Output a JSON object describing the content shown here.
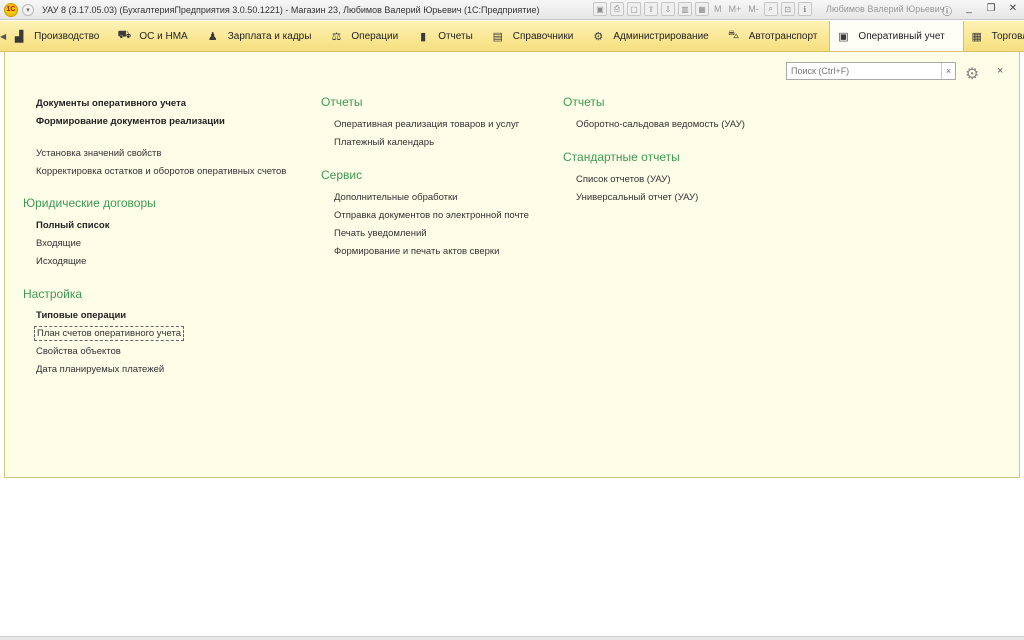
{
  "titlebar": {
    "logo": "1С",
    "title": "УАУ 8 (3.17.05.03) (БухгалтерияПредприятия 3.0.50.1221) - Магазин 23, Любимов Валерий Юрьевич  (1С:Предприятие)",
    "tools": [
      "M",
      "M+",
      "M-"
    ],
    "user": "Любимов Валерий Юрьевич",
    "win_min": "_",
    "win_restore": "❐",
    "win_close": "✕"
  },
  "sections": [
    {
      "label": "Производство",
      "icon": "factory-icon",
      "glyph": "▟"
    },
    {
      "label": "ОС и НМА",
      "icon": "truck-icon",
      "glyph": "⛟"
    },
    {
      "label": "Зарплата и кадры",
      "icon": "person-icon",
      "glyph": "♟"
    },
    {
      "label": "Операции",
      "icon": "operations-icon",
      "glyph": "⚖"
    },
    {
      "label": "Отчеты",
      "icon": "chart-icon",
      "glyph": "▮"
    },
    {
      "label": "Справочники",
      "icon": "books-icon",
      "glyph": "▤"
    },
    {
      "label": "Администрирование",
      "icon": "gear-icon",
      "glyph": "⚙"
    },
    {
      "label": "Автотранспорт",
      "icon": "car-icon",
      "glyph": "⛍"
    },
    {
      "label": "Оперативный учет",
      "icon": "monitor-icon",
      "glyph": "▣"
    },
    {
      "label": "Торговля",
      "icon": "calculator-icon",
      "glyph": "▦"
    }
  ],
  "search": {
    "placeholder": "Поиск (Ctrl+F)",
    "clear": "×"
  },
  "panel": {
    "close": "×"
  },
  "col1": {
    "items_top": [
      {
        "label": "Документы оперативного учета",
        "bold": true
      },
      {
        "label": "Формирование документов реализации",
        "bold": true
      },
      {
        "label": "Установка значений свойств",
        "bold": false
      },
      {
        "label": "Корректировка остатков и оборотов оперативных счетов",
        "bold": false
      }
    ],
    "group_contracts": "Юридические договоры",
    "contracts_items": [
      "Полный список",
      "Входящие",
      "Исходящие"
    ],
    "group_settings": "Настройка",
    "settings_items": [
      "Типовые операции",
      "План счетов оперативного учета",
      "Свойства объектов",
      "Дата планируемых платежей"
    ]
  },
  "col2": {
    "group_reports": "Отчеты",
    "reports_items": [
      "Оперативная реализация товаров и услуг",
      "Платежный календарь"
    ],
    "group_service": "Сервис",
    "service_items": [
      "Дополнительные обработки",
      "Отправка документов по электронной почте",
      "Печать уведомлений",
      "Формирование и печать актов сверки"
    ]
  },
  "col3": {
    "group_reports": "Отчеты",
    "reports_items": [
      "Оборотно-сальдовая ведомость (УАУ)"
    ],
    "group_standard": "Стандартные отчеты",
    "standard_items": [
      "Список отчетов (УАУ)",
      "Универсальный отчет (УАУ)"
    ]
  }
}
